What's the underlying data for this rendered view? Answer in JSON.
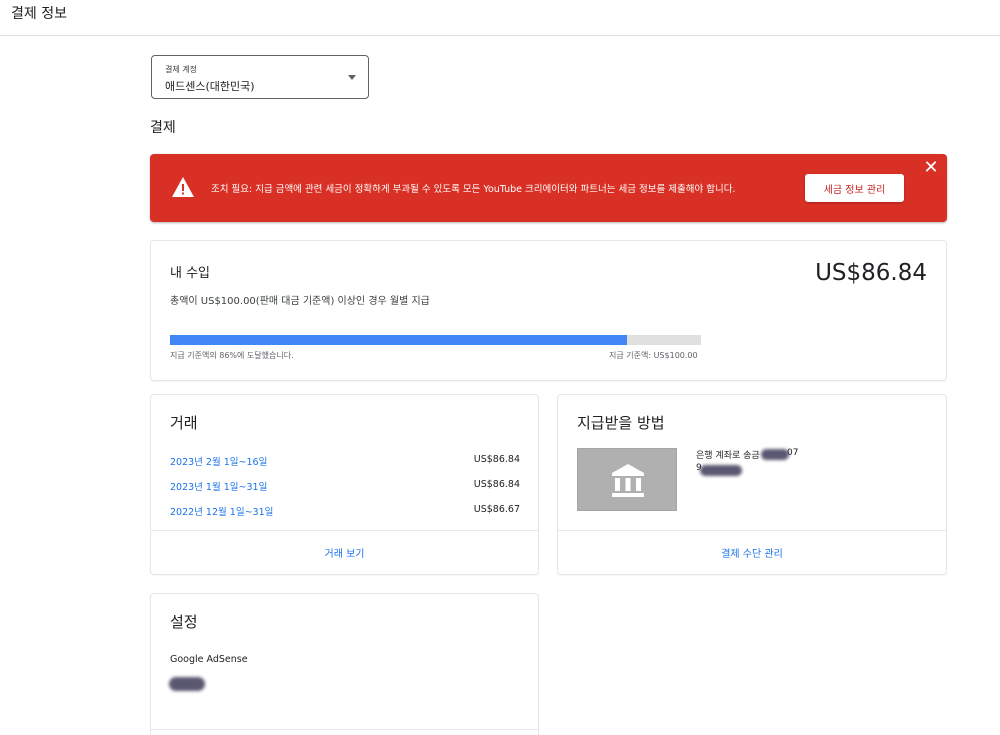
{
  "header": {
    "title": "결제 정보"
  },
  "account_select": {
    "label": "결제 계정",
    "value": "애드센스(대한민국)"
  },
  "payments_heading": "결제",
  "alert": {
    "message": "조치 필요: 지급 금액에 관련 세금이 정확하게 부과될 수 있도록 모든 YouTube 크리에이터와 파트너는 세금 정보를 제출해야 합니다.",
    "button_label": "세금 정보 관리",
    "close_glyph": "✕",
    "color": "#d93025"
  },
  "earnings": {
    "title": "내 수입",
    "amount": "US$86.84",
    "description": "총액이 US$100.00(판매 대금 기준액) 이상인 경우 월별 지급",
    "progress_fraction": 0.86,
    "progress_reached_text": "지급 기준액의 86%에 도달했습니다.",
    "threshold_text": "지급 기준액: US$100.00",
    "bar_color": "#4285f4"
  },
  "transactions": {
    "title": "거래",
    "rows": [
      {
        "period": "2023년 2월 1일~16일",
        "amount": "US$86.84"
      },
      {
        "period": "2023년 1월 1일~31일",
        "amount": "US$86.84"
      },
      {
        "period": "2022년 12월 1일~31일",
        "amount": "US$86.67"
      }
    ],
    "view_label": "거래 보기"
  },
  "payment_method": {
    "title": "지급받을 방법",
    "icon": "bank-icon",
    "bank_label": "은행 계좌로 송금 •",
    "account_tail": "07",
    "account_prefix": "9",
    "manage_label": "결제 수단 관리"
  },
  "settings": {
    "title": "설정",
    "product": "Google AdSense"
  }
}
